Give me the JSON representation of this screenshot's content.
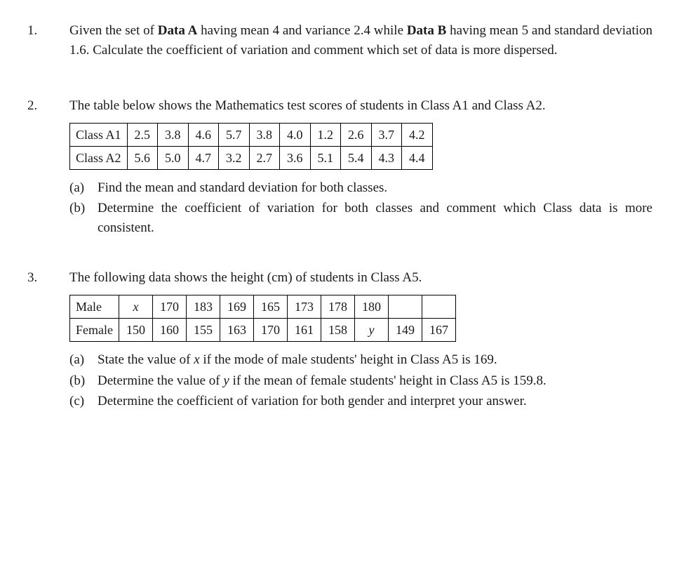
{
  "questions": [
    {
      "number": "1.",
      "text_parts": [
        "Given the set of ",
        "Data A",
        " having mean 4 and variance 2.4 while ",
        "Data B",
        " having mean 5 and standard deviation 1.6. Calculate the coefficient of variation and comment which set of data is more dispersed."
      ]
    },
    {
      "number": "2.",
      "intro": "The table below shows the Mathematics test scores of students in Class A1 and Class A2.",
      "table": {
        "rows": [
          {
            "label": "Class A1",
            "cells": [
              "2.5",
              "3.8",
              "4.6",
              "5.7",
              "3.8",
              "4.0",
              "1.2",
              "2.6",
              "3.7",
              "4.2"
            ]
          },
          {
            "label": "Class A2",
            "cells": [
              "5.6",
              "5.0",
              "4.7",
              "3.2",
              "2.7",
              "3.6",
              "5.1",
              "5.4",
              "4.3",
              "4.4"
            ]
          }
        ]
      },
      "subs": [
        {
          "label": "(a)",
          "text": "Find the mean and standard deviation for both classes."
        },
        {
          "label": "(b)",
          "text": "Determine the coefficient of variation for both classes and comment which Class data is more consistent."
        }
      ]
    },
    {
      "number": "3.",
      "intro": "The following data shows the height (cm) of students in Class A5.",
      "table": {
        "rows": [
          {
            "label": "Male",
            "cells": [
              "x",
              "170",
              "183",
              "169",
              "165",
              "173",
              "178",
              "180",
              "",
              ""
            ]
          },
          {
            "label": "Female",
            "cells": [
              "150",
              "160",
              "155",
              "163",
              "170",
              "161",
              "158",
              "y",
              "149",
              "167"
            ]
          }
        ],
        "italic_cells": {
          "0": [
            0
          ],
          "1": [
            7
          ]
        }
      },
      "subs": [
        {
          "label": "(a)",
          "text_parts": [
            "State the value of ",
            "x",
            " if the mode of male students' height in Class A5 is 169."
          ]
        },
        {
          "label": "(b)",
          "text_parts": [
            "Determine the value of ",
            "y",
            " if the mean of female students' height in Class A5 is 159.8."
          ]
        },
        {
          "label": "(c)",
          "text": "Determine the coefficient of variation for both gender and interpret your answer."
        }
      ]
    }
  ]
}
